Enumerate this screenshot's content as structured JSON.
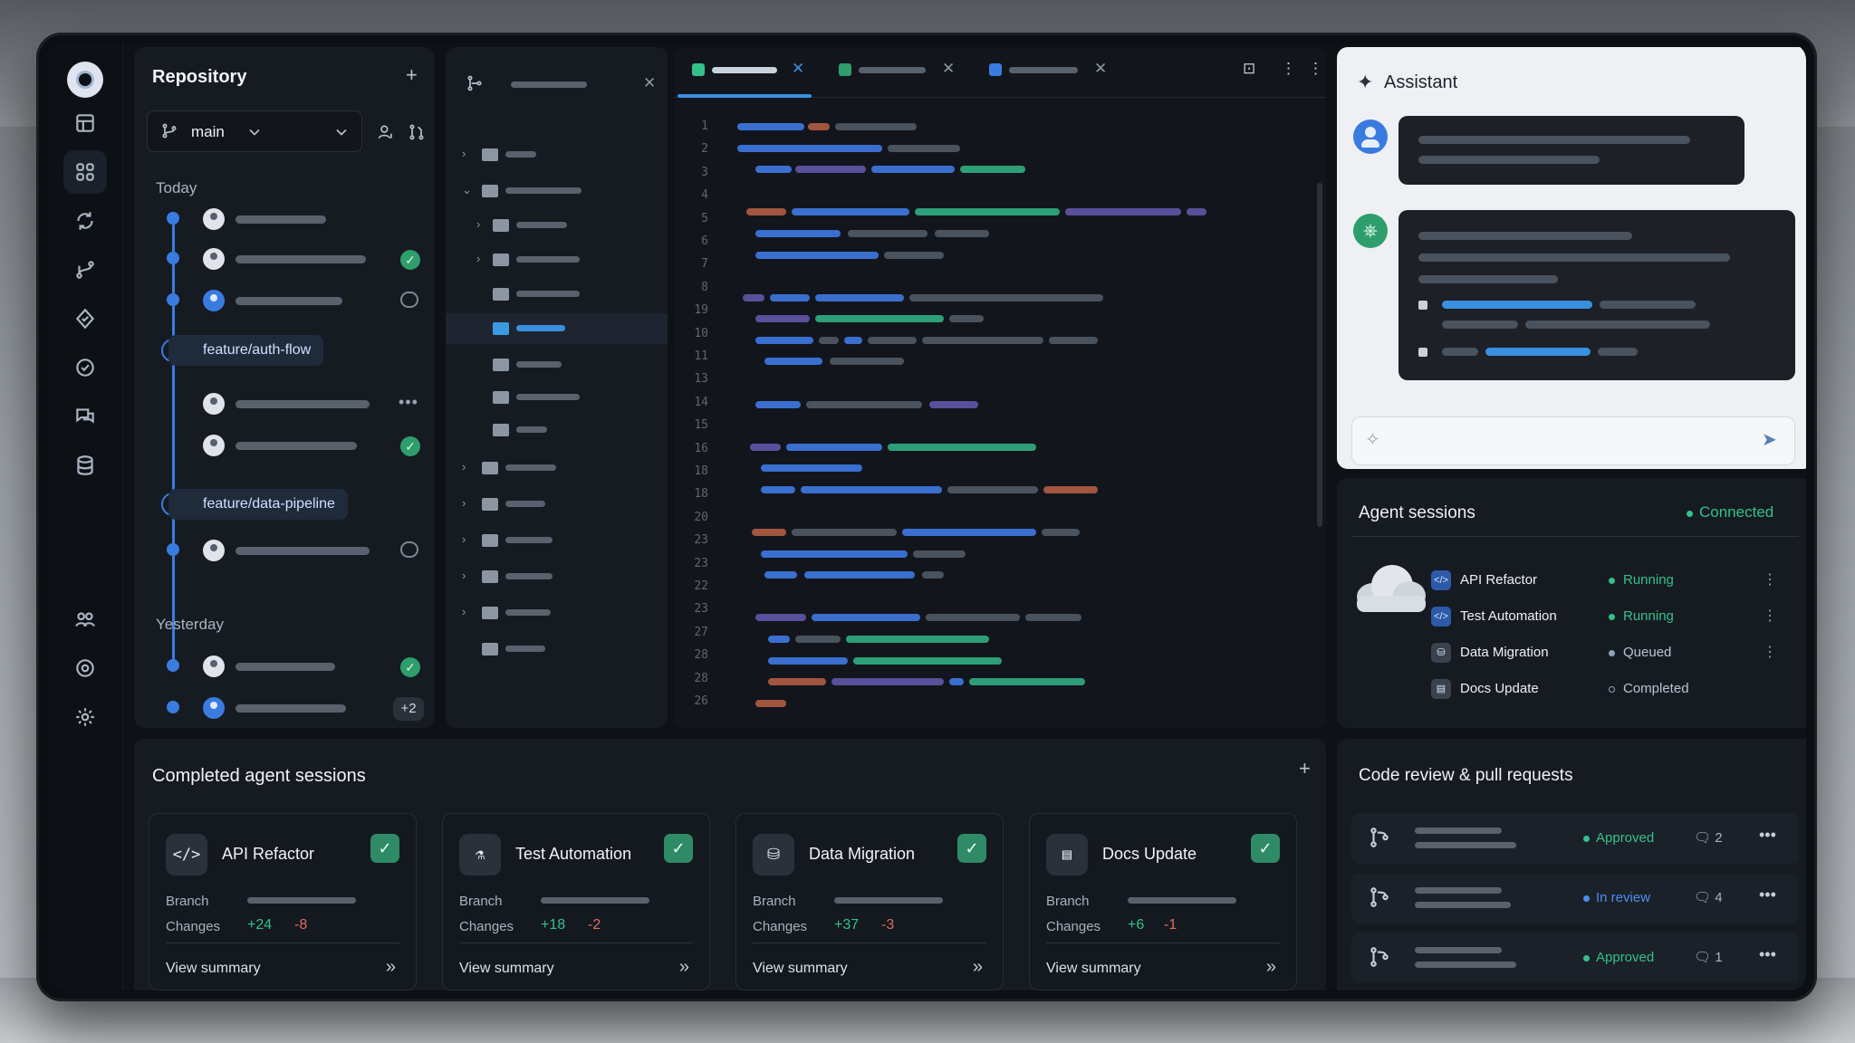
{
  "repository": {
    "title": "Repository",
    "add_icon": "+",
    "branch": "main",
    "today_label": "Today",
    "yesterday_label": "Yesterday",
    "branches": [
      "feature/auth-flow",
      "feature/data-pipeline"
    ],
    "overflow_badge": "+2"
  },
  "editor": {
    "line_numbers": [
      "1",
      "2",
      "3",
      "4",
      "5",
      "6",
      "7",
      "8",
      "19",
      "10",
      "11",
      "13",
      "14",
      "15",
      "16",
      "18",
      "18",
      "20",
      "23",
      "23",
      "22",
      "23",
      "27",
      "28",
      "28",
      "26"
    ]
  },
  "assistant": {
    "title": "Assistant"
  },
  "agent_sessions": {
    "title": "Agent sessions",
    "status": "Connected",
    "items": [
      {
        "name": "API Refactor",
        "status": "Running",
        "status_color": "#35c08a",
        "icon": "code-icon"
      },
      {
        "name": "Test Automation",
        "status": "Running",
        "status_color": "#35c08a",
        "icon": "code-icon"
      },
      {
        "name": "Data Migration",
        "status": "Queued",
        "status_color": "#8fa2bb",
        "icon": "database-icon"
      },
      {
        "name": "Docs Update",
        "status": "Completed",
        "status_color": "#8fa2bb",
        "icon": "document-icon"
      }
    ]
  },
  "completed": {
    "title": "Completed agent sessions",
    "add_icon": "+",
    "branch_label": "Branch",
    "changes_label": "Changes",
    "view_summary": "View summary",
    "cards": [
      {
        "name": "API Refactor",
        "icon": "</>",
        "added": "+24",
        "removed": "-8"
      },
      {
        "name": "Test Automation",
        "icon": "⚗",
        "added": "+18",
        "removed": "-2"
      },
      {
        "name": "Data Migration",
        "icon": "⛁",
        "added": "+37",
        "removed": "-3"
      },
      {
        "name": "Docs Update",
        "icon": "▤",
        "added": "+6",
        "removed": "-1"
      }
    ]
  },
  "code_review": {
    "title": "Code review & pull requests",
    "rows": [
      {
        "status": "Approved",
        "status_color": "#35c08a",
        "comments": "2"
      },
      {
        "status": "In review",
        "status_color": "#4a8ff0",
        "comments": "4"
      },
      {
        "status": "Approved",
        "status_color": "#35c08a",
        "comments": "1"
      }
    ]
  },
  "colors": {
    "accent": "#3a7be0",
    "success": "#35c08a",
    "danger": "#e26b5a"
  }
}
